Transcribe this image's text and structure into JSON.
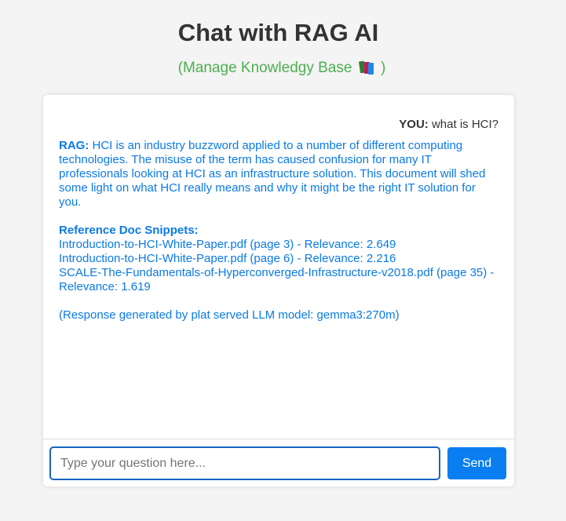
{
  "header": {
    "title": "Chat with RAG AI",
    "kb_link_open": "(Manage Knowledgy Base",
    "kb_link_close": ")",
    "kb_icon": "books-icon"
  },
  "chat": {
    "user_message": {
      "speaker": "YOU:",
      "text": "what is HCI?"
    },
    "rag_message": {
      "speaker": "RAG:",
      "text": "HCI is an industry buzzword applied to a number of different computing technologies. The misuse of the term has caused confusion for many IT professionals looking at HCI as an infrastructure solution. This document will shed some light on what HCI really means and why it might be the right IT solution for you.",
      "refs_title": "Reference Doc Snippets:",
      "refs": [
        "Introduction-to-HCI-White-Paper.pdf (page 3) - Relevance: 2.649",
        "Introduction-to-HCI-White-Paper.pdf (page 6) - Relevance: 2.216",
        "SCALE-The-Fundamentals-of-Hyperconverged-Infrastructure-v2018.pdf (page 35) - Relevance: 1.619"
      ],
      "footer": "(Response generated by plat served LLM model: gemma3:270m)"
    }
  },
  "input": {
    "placeholder": "Type your question here...",
    "value": "",
    "send_label": "Send"
  },
  "colors": {
    "accent": "#0a7ef0",
    "rag_text": "#0a7ae6",
    "link": "#4caf50",
    "title": "#333333"
  }
}
